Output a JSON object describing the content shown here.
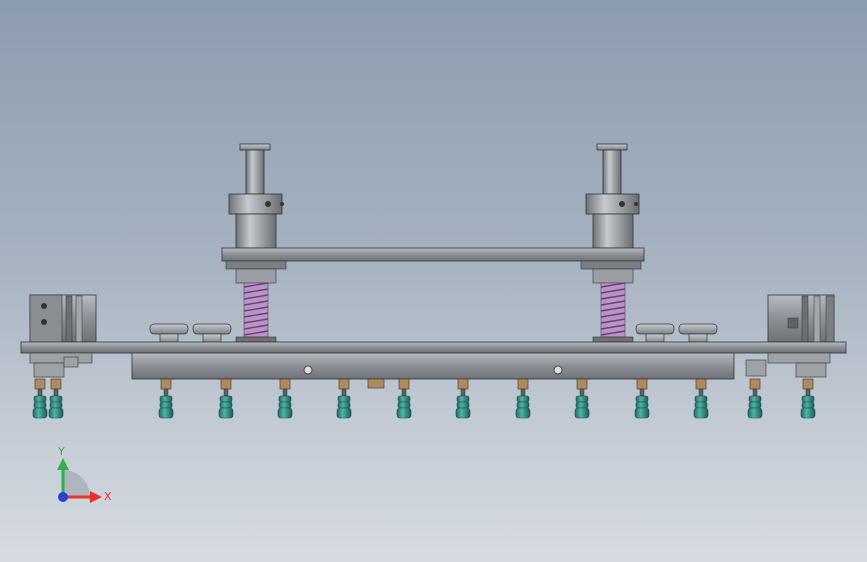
{
  "view": {
    "background_top": "#8c9caf",
    "background_bottom": "#d6dbe1"
  },
  "triad": {
    "x_label": "X",
    "y_label": "Y",
    "x_color": "#e8322a",
    "y_color": "#2fb04a",
    "z_color": "#2a3fd6"
  },
  "model": {
    "metal_color": "#8a8d91",
    "spring_color": "#a679b5",
    "nozzle_color": "#2e8a80",
    "fitting_color": "#b08a5a"
  }
}
